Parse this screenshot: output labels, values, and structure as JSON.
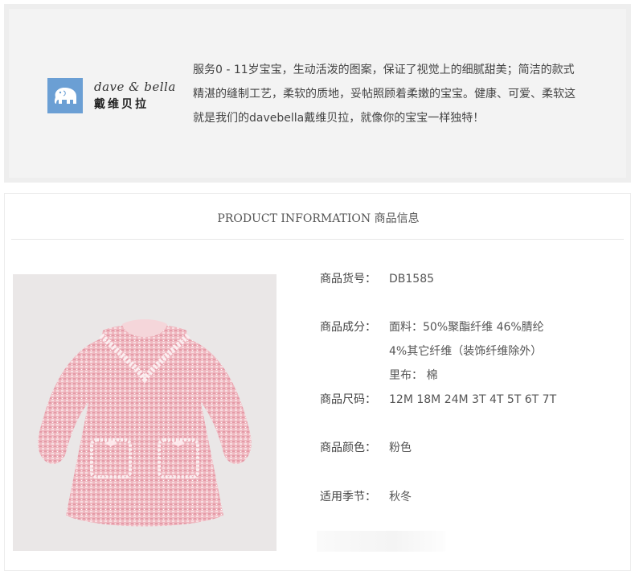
{
  "brand": {
    "logo_en": "dave & bella",
    "logo_cn": "戴维贝拉",
    "logo_icon": "elephant-icon",
    "logo_color": "#6b9fd4",
    "lines": [
      "服务0 - 11岁宝宝，生动活泼的图案，保证了视觉上的细腻甜美；简洁的款式",
      "精湛的缝制工艺，柔软的质地，妥帖照顾着柔嫩的宝宝。健康、可爱、柔软这",
      "就是我们的davebella戴维贝拉，就像你的宝宝一样独特！"
    ]
  },
  "info": {
    "title": "PRODUCT INFORMATION 商品信息",
    "sku_label": "商品货号：",
    "sku": "DB1585",
    "material_label": "商品成分：",
    "material_lines": [
      "面料：50%聚酯纤维 46%腈纶",
      "4%其它纤维（装饰纤维除外）",
      "里布： 棉"
    ],
    "size_label": "商品尺码：",
    "sizes": "12M 18M 24M 3T 4T 5T 6T 7T",
    "color_label": "商品颜色：",
    "color": "粉色",
    "season_label": "适用季节：",
    "season": "秋冬"
  },
  "product_image": {
    "description_icon": "pink-tweed-dress-image",
    "dress_color": "#e9a9b3"
  }
}
